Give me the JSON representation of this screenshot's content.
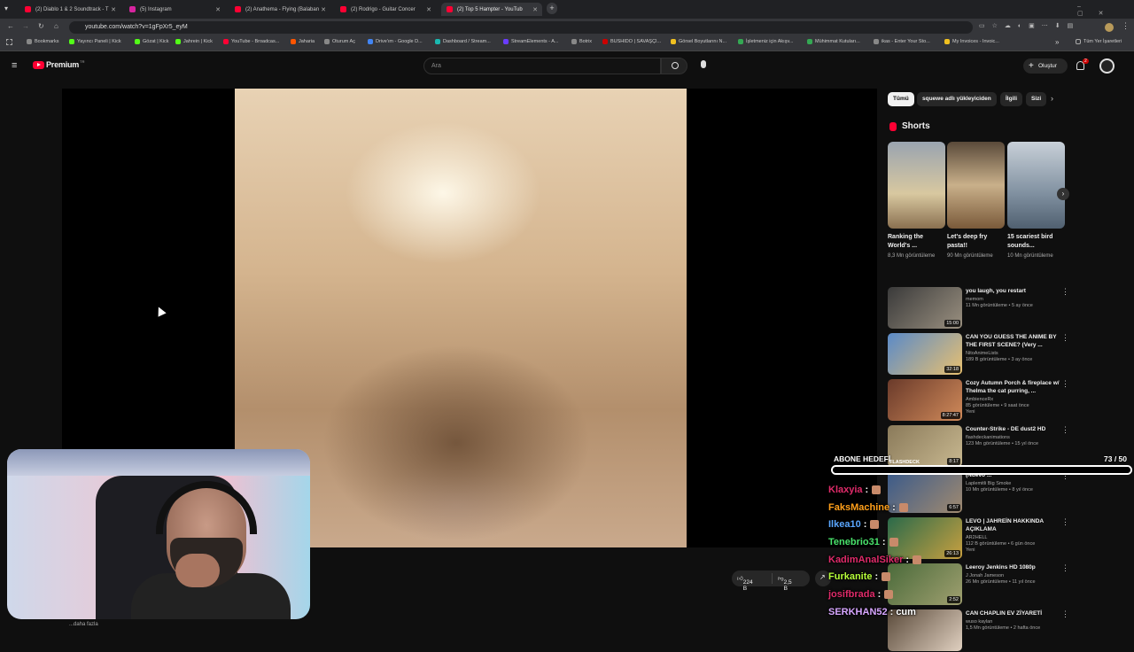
{
  "browser": {
    "tabs": [
      {
        "label": "(2) Diablo 1 & 2 Soundtrack - T",
        "color": "#ff0033",
        "active": false
      },
      {
        "label": "(5) Instagram",
        "color": "#d6249f",
        "active": false
      },
      {
        "label": "(2) Anathema - Flying (Balaban",
        "color": "#ff0033",
        "active": false
      },
      {
        "label": "(2) Rodrigo - Guitar Concer",
        "color": "#ff0033",
        "active": false
      },
      {
        "label": "(2) Top 5 Hampter - YouTub",
        "color": "#ff0033",
        "active": true
      }
    ],
    "url": "youtube.com/watch?v=1gFpXr5_eyM",
    "bookmarks": [
      "Bookmarks",
      "Yayıncı Paneli | Kick",
      "Gözat | Kick",
      "Jahrein | Kick",
      "YouTube - Broadcas...",
      "Jaharia",
      "Oturum Aç",
      "Drive'ım - Google D...",
      "Dashboard / Stream...",
      "StreamElements - A...",
      "Botrix",
      "BUSHIDO | SAVAŞÇI...",
      "Görsel Boyutlarını N...",
      "İşletmeniz için Akışv...",
      "Mühimmat Kutuları...",
      "ikas - Enter Your Sto...",
      "My Invoices - Invoic..."
    ],
    "all_bookmarks": "Tüm Yer İşaretleri"
  },
  "youtube": {
    "logo": "Premium",
    "logo_super": "TR",
    "search_placeholder": "Ara",
    "create_label": "Oluştur",
    "notif_count": "2"
  },
  "chips": [
    "Tümü",
    "squewe adlı yükleyiciden",
    "İlgili",
    "Sizi"
  ],
  "shorts": {
    "title": "Shorts",
    "items": [
      {
        "title": "Ranking the World's ...",
        "views": "8,3 Mn görüntüleme"
      },
      {
        "title": "Let's deep fry pasta!!",
        "views": "90 Mn görüntüleme"
      },
      {
        "title": "15 scariest bird sounds...",
        "views": "10 Mn görüntüleme"
      }
    ]
  },
  "videos": [
    {
      "title": "you laugh, you restart",
      "channel": "memom",
      "meta": "11 Mn görüntüleme • 5 ay önce",
      "duration": "15:00"
    },
    {
      "title": "CAN YOU GUESS THE ANIME BY THE FIRST SCENE? (Very ...",
      "channel": "NitoAnimeLists",
      "meta": "189 B görüntüleme • 3 ay önce",
      "duration": "32:18"
    },
    {
      "title": "Cozy Autumn Porch & fireplace w/ Thelma the cat purring, ...",
      "channel": "AmbienceRx",
      "meta": "85 görüntüleme • 9 saat önce",
      "extra": "Yeni",
      "duration": "8:27:47"
    },
    {
      "title": "Counter-Strike - DE dust2 HD",
      "channel": "flashdeckanimations",
      "meta": "123 Mn görüntüleme • 15 yıl önce",
      "duration": "8:17"
    },
    {
      "title": "(Nuevo ...",
      "channel": "Laplemitli Big Smoke",
      "meta": "10 Mn görüntüleme • 8 yıl önce",
      "duration": "6:57"
    },
    {
      "title": "LEVO | JAHREİN HAKKINDA AÇIKLAMA",
      "channel": "AR2HELL",
      "meta": "112 B görüntüleme • 6 gün önce",
      "extra": "Yeni",
      "duration": "26:13"
    },
    {
      "title": "Leeroy Jenkins HD 1080p",
      "channel": "J Jonah Jameson",
      "meta": "26 Mn görüntüleme • 11 yıl önce",
      "duration": "2:52"
    },
    {
      "title": "CAN CHAPLIN EV ZİYARETİ",
      "channel": "wuso kaylan",
      "meta": "1,5 Mn görüntüleme • 2 hafta önce",
      "duration": ""
    }
  ],
  "goal": {
    "label": "ABONE HEDEFİ",
    "count": "73",
    "total": "/ 50",
    "progress": 1.0
  },
  "chat": [
    {
      "user": "Klaxyia",
      "color": "#e02b6a",
      "text": ""
    },
    {
      "user": "FaksMachine",
      "color": "#ff9f1a",
      "text": ""
    },
    {
      "user": "Ilkea10",
      "color": "#5aa7ff",
      "text": ""
    },
    {
      "user": "Tenebrio31",
      "color": "#49e36b",
      "text": ""
    },
    {
      "user": "KadimAnalSiker",
      "color": "#e02b6a",
      "text": ""
    },
    {
      "user": "Furkanite",
      "color": "#b6ff3a",
      "text": ""
    },
    {
      "user": "josifbrada",
      "color": "#e02b6a",
      "text": ""
    },
    {
      "user": "SERKHAN52",
      "color": "#d7a6ff",
      "text": "cum"
    }
  ],
  "actions": {
    "likes": "224 B",
    "dislikes": "2,5 B"
  },
  "description_more": "...daha fazla",
  "watermark": "FLASHDECK"
}
